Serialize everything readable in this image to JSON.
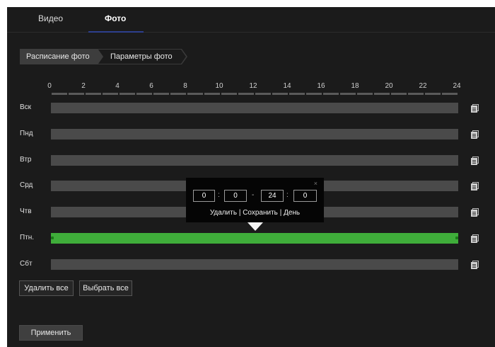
{
  "tabs": [
    {
      "label": "Видео",
      "active": false
    },
    {
      "label": "Фото",
      "active": true
    }
  ],
  "steps": [
    {
      "label": "Расписание фото",
      "active": true
    },
    {
      "label": "Параметры фото",
      "active": false
    }
  ],
  "hours": [
    "0",
    "2",
    "4",
    "6",
    "8",
    "10",
    "12",
    "14",
    "16",
    "18",
    "20",
    "22",
    "24"
  ],
  "days": [
    {
      "label": "Вск",
      "scheduled": false
    },
    {
      "label": "Пнд",
      "scheduled": false
    },
    {
      "label": "Втр",
      "scheduled": false
    },
    {
      "label": "Срд",
      "scheduled": false
    },
    {
      "label": "Чтв",
      "scheduled": false
    },
    {
      "label": "Птн.",
      "scheduled": true,
      "range": [
        "0:0",
        "24:0"
      ]
    },
    {
      "label": "Сбт",
      "scheduled": false
    }
  ],
  "popup": {
    "close": "×",
    "start_hour": "0",
    "start_minute": "0",
    "end_hour": "24",
    "end_minute": "0",
    "colon": ":",
    "dash": "-",
    "delete": "Удалить",
    "save": "Сохранить",
    "day": "День",
    "divider": "|"
  },
  "buttons": {
    "delete_all": "Удалить все",
    "select_all": "Выбрать все",
    "apply": "Применить"
  },
  "colors": {
    "background": "#1b1b1b",
    "bar_empty": "#4a4a4a",
    "bar_scheduled": "#3fad3a",
    "tab_underline": "#2d3f8e"
  },
  "icons": {
    "copy": "copy-icon",
    "close": "close-icon",
    "pointer": "triangle-pointer"
  }
}
